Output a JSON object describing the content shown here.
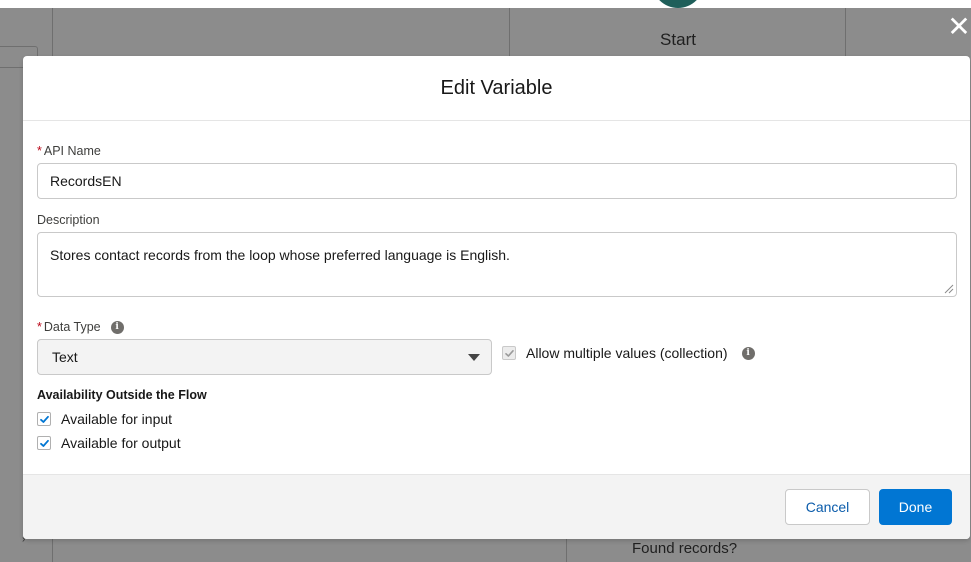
{
  "background": {
    "start_label": "Start",
    "found_records_label": "Found records?",
    "close_glyph": "✕"
  },
  "modal": {
    "title": "Edit Variable",
    "api_name": {
      "required_marker": "*",
      "label": "API Name",
      "value": "RecordsEN"
    },
    "description": {
      "label": "Description",
      "value": "Stores contact records from the loop whose preferred language is English."
    },
    "data_type": {
      "required_marker": "*",
      "label": "Data Type",
      "info_icon": "info-icon",
      "selected": "Text"
    },
    "allow_multiple": {
      "label": "Allow multiple values (collection)",
      "checked": true,
      "disabled": true,
      "info_icon": "info-icon"
    },
    "availability": {
      "heading": "Availability Outside the Flow",
      "options": [
        {
          "label": "Available for input",
          "checked": true
        },
        {
          "label": "Available for output",
          "checked": true
        }
      ]
    },
    "footer": {
      "cancel_label": "Cancel",
      "done_label": "Done"
    }
  },
  "colors": {
    "brand": "#0176d3",
    "link": "#0b5cab",
    "required": "#ba0517",
    "overlay": "#8c8c8c",
    "start_node": "#1f5f5a"
  }
}
